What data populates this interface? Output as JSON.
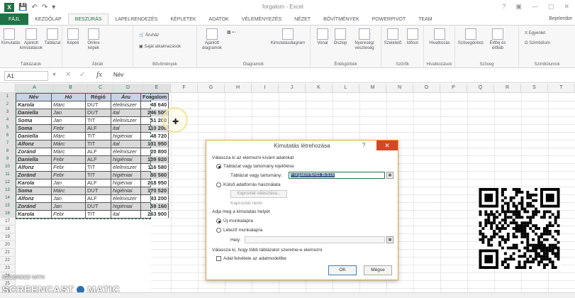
{
  "app": {
    "logo": "X",
    "title": "forgalom - Excel",
    "user": "Bejelentke",
    "window_controls": [
      "?",
      "▣",
      "—",
      "▢",
      "✕"
    ]
  },
  "tabs": [
    {
      "label": "FÁJL"
    },
    {
      "label": "KEZDŐLAP"
    },
    {
      "label": "BESZÚRÁS"
    },
    {
      "label": "LAPELRENDEZÉS"
    },
    {
      "label": "KÉPLETEK"
    },
    {
      "label": "ADATOK"
    },
    {
      "label": "VÉLEMÉNYEZÉS"
    },
    {
      "label": "NÉZET"
    },
    {
      "label": "BŐVÍTMÉNYEK"
    },
    {
      "label": "POWERPIVOT"
    },
    {
      "label": "TEAM"
    }
  ],
  "ribbon": {
    "groups": [
      {
        "label": "Táblázatok",
        "buttons": [
          "Kimutatás",
          "Ajánlott kimutatások",
          "Táblázat"
        ]
      },
      {
        "label": "Ábrák",
        "buttons": [
          "Képek",
          "Online képek"
        ]
      },
      {
        "label": "Bővítmények",
        "buttons": [
          "Áruház",
          "Saját alkalmazások"
        ]
      },
      {
        "label": "Diagramok",
        "buttons": [
          "Ajánlott diagramok",
          "Kimutatásdiagram"
        ]
      },
      {
        "label": "Értékgörbék",
        "buttons": [
          "Vonal",
          "Oszlop",
          "Nyereség/ veszteség"
        ]
      },
      {
        "label": "Szűrők",
        "buttons": [
          "Szeletelő",
          "Idősor"
        ]
      },
      {
        "label": "Hivatkozások",
        "buttons": [
          "Hivatkozás"
        ]
      },
      {
        "label": "Szöveg",
        "buttons": [
          "Szövegdoboz",
          "Élőfej és élőláb"
        ]
      },
      {
        "label": "Szimbólumok",
        "buttons": [
          "Egyenlet",
          "Szimbólum"
        ]
      }
    ]
  },
  "formula_bar": {
    "name_box": "A1",
    "fx": "fx",
    "value": "Név"
  },
  "columns": [
    "A",
    "B",
    "C",
    "D",
    "E",
    "F",
    "G",
    "H",
    "I",
    "J",
    "K",
    "L",
    "M",
    "N",
    "O",
    "P",
    "Q",
    "R",
    "S",
    "T",
    "U"
  ],
  "rows": [
    "1",
    "2",
    "3",
    "4",
    "5",
    "6",
    "7",
    "8",
    "9",
    "10",
    "11",
    "12",
    "13",
    "14",
    "15",
    "16",
    "17",
    "18",
    "19",
    "20",
    "21",
    "22",
    "23",
    "24",
    "25",
    "26"
  ],
  "table": {
    "headers": [
      "Név",
      "Hó",
      "Régió",
      "Áru",
      "Forgalom"
    ],
    "rows": [
      [
        "Karola",
        "Márc",
        "DUT",
        "élelmiszer",
        "48 640"
      ],
      [
        "Daniella",
        "Jan",
        "DUT",
        "ital",
        "246 500"
      ],
      [
        "Soma",
        "Jan",
        "TIT",
        "élelmiszer",
        "51 200"
      ],
      [
        "Soma",
        "Febr",
        "ALF",
        "ital",
        "110 200"
      ],
      [
        "Daniella",
        "Márc",
        "TIT",
        "higiéniai",
        "48 720"
      ],
      [
        "Alfonz",
        "Márc",
        "TIT",
        "ital",
        "131 950"
      ],
      [
        "Zoránd",
        "Márc",
        "ALF",
        "élelmiszer",
        "20 800"
      ],
      [
        "Daniella",
        "Febr",
        "ALF",
        "higiéniai",
        "109 920"
      ],
      [
        "Alfonz",
        "Febr",
        "TIT",
        "élelmiszer",
        "116 580"
      ],
      [
        "Zoránd",
        "Febr",
        "TIT",
        "higiéniai",
        "50 560"
      ],
      [
        "Karola",
        "Jan",
        "ALF",
        "higiéniai",
        "218 950"
      ],
      [
        "Soma",
        "Márc",
        "DUT",
        "higiéniai",
        "170 520"
      ],
      [
        "Alfonz",
        "Jan",
        "ALF",
        "élelmiszer",
        "43 200"
      ],
      [
        "Zoránd",
        "Jan",
        "DUT",
        "higiéniai",
        "59 160"
      ],
      [
        "Karola",
        "Febr",
        "TIT",
        "ital",
        "263 900"
      ]
    ]
  },
  "dialog": {
    "title": "Kimutatás létrehozása",
    "help": "?",
    "close": "✕",
    "section1": "Válassza ki az elemezni kívánt adatokat",
    "option_table": "Táblázat vagy tartomány kijelölése",
    "range_label": "Táblázat vagy tartomány:",
    "range_value": "Forgalom!$A$1:$E$16",
    "option_external": "Külső adatforrás használata",
    "connection_button": "Kapcsolat választása...",
    "connection_name": "Kapcsolat neve:",
    "section2": "Adja meg a kimutatás helyét",
    "option_new": "Új munkalapra",
    "option_existing": "Létező munkalapra",
    "location_label": "Hely:",
    "section3": "Válassza ki, hogy több táblázatot szeretne-e elemezni",
    "checkbox_label": "Adat felvétele az adatmodellbe",
    "ok": "OK",
    "cancel": "Mégse"
  },
  "watermark": {
    "line1": "RECORDED WITH",
    "line2a": "SCREENCAST",
    "line2b": "MATIC"
  }
}
